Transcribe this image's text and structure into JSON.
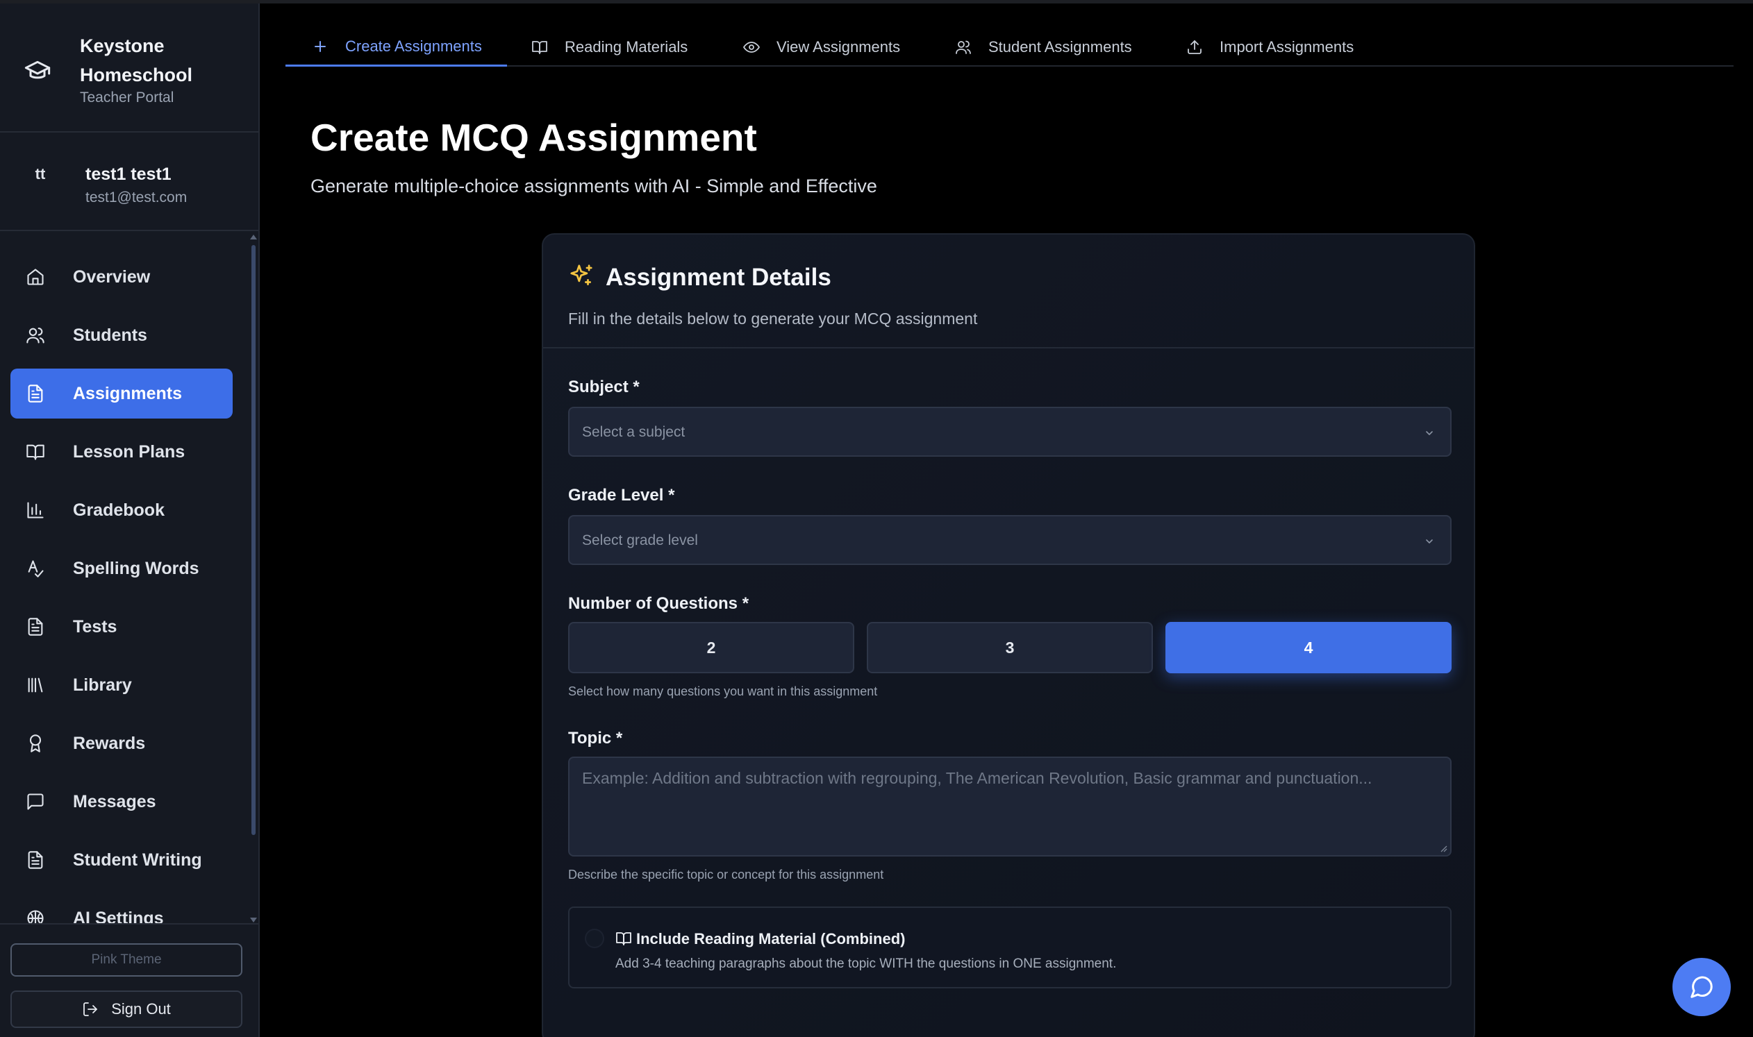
{
  "brand": {
    "name": "Keystone Homeschool",
    "subtitle": "Teacher Portal",
    "icon": "graduation-cap-icon"
  },
  "user": {
    "initials": "tt",
    "name": "test1 test1",
    "email": "test1@test.com"
  },
  "sidebar": {
    "items": [
      {
        "label": "Overview",
        "icon": "home-icon",
        "active": false
      },
      {
        "label": "Students",
        "icon": "users-icon",
        "active": false
      },
      {
        "label": "Assignments",
        "icon": "file-text-icon",
        "active": true
      },
      {
        "label": "Lesson Plans",
        "icon": "book-open-icon",
        "active": false
      },
      {
        "label": "Gradebook",
        "icon": "bar-chart-icon",
        "active": false
      },
      {
        "label": "Spelling Words",
        "icon": "spell-check-icon",
        "active": false
      },
      {
        "label": "Tests",
        "icon": "file-text-icon",
        "active": false
      },
      {
        "label": "Library",
        "icon": "library-icon",
        "active": false
      },
      {
        "label": "Rewards",
        "icon": "award-icon",
        "active": false
      },
      {
        "label": "Messages",
        "icon": "message-square-icon",
        "active": false
      },
      {
        "label": "Student Writing",
        "icon": "file-text-icon",
        "active": false
      },
      {
        "label": "AI Settings",
        "icon": "brain-icon",
        "active": false
      }
    ],
    "theme_button": "Pink Theme",
    "signout_button": "Sign Out"
  },
  "tabs": [
    {
      "label": "Create Assignments",
      "icon": "plus-icon",
      "active": true
    },
    {
      "label": "Reading Materials",
      "icon": "book-open-icon",
      "active": false
    },
    {
      "label": "View Assignments",
      "icon": "eye-icon",
      "active": false
    },
    {
      "label": "Student Assignments",
      "icon": "users-icon",
      "active": false
    },
    {
      "label": "Import Assignments",
      "icon": "upload-icon",
      "active": false
    }
  ],
  "page": {
    "title": "Create MCQ Assignment",
    "subtitle": "Generate multiple-choice assignments with AI - Simple and Effective"
  },
  "card": {
    "title": "Assignment Details",
    "description": "Fill in the details below to generate your MCQ assignment",
    "subject": {
      "label": "Subject *",
      "placeholder": "Select a subject"
    },
    "grade": {
      "label": "Grade Level *",
      "placeholder": "Select grade level"
    },
    "questions": {
      "label": "Number of Questions *",
      "options": [
        "2",
        "3",
        "4"
      ],
      "selected": "4",
      "hint": "Select how many questions you want in this assignment"
    },
    "topic": {
      "label": "Topic *",
      "placeholder": "Example: Addition and subtraction with regrouping, The American Revolution, Basic grammar and punctuation...",
      "hint": "Describe the specific topic or concept for this assignment"
    },
    "reading": {
      "title": "Include Reading Material (Combined)",
      "description": "Add 3-4 teaching paragraphs about the topic WITH the questions in ONE assignment."
    }
  },
  "colors": {
    "accent": "#3d6ee8",
    "active_tab": "#7ea3ff",
    "sparkle": "#f5c542",
    "background": "#000000",
    "sidebar": "#151922"
  }
}
